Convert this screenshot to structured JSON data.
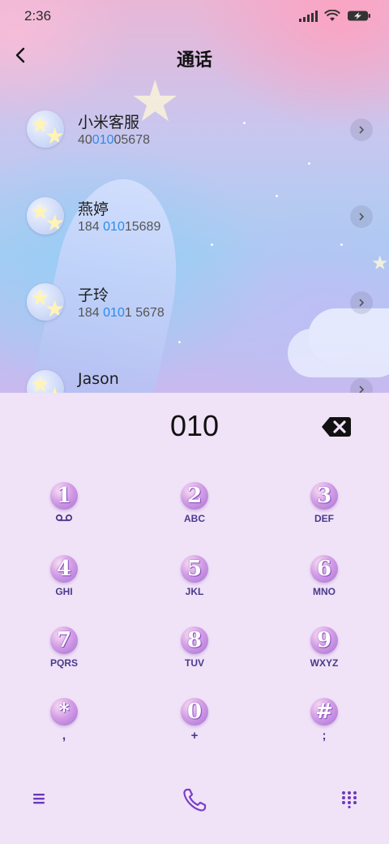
{
  "status_bar": {
    "time": "2:36",
    "icons": [
      "signal-icon",
      "wifi-icon",
      "battery-charging-icon"
    ]
  },
  "header": {
    "title": "通话",
    "back_icon": "chevron-left-icon"
  },
  "contacts": [
    {
      "name": "小米客服",
      "number_pre": "40",
      "number_match": "010",
      "number_post": "05678"
    },
    {
      "name": "燕婷",
      "number_pre": "184 ",
      "number_match": "010",
      "number_post": "15689"
    },
    {
      "name": "子玲",
      "number_pre": "184 ",
      "number_match": "010",
      "number_post": "1 5678"
    },
    {
      "name": "Jason",
      "number_pre": "",
      "number_match": "",
      "number_post": ""
    }
  ],
  "dialer": {
    "input_value": "010",
    "keys": [
      {
        "digit": "1",
        "sub": "ᴑᴑ"
      },
      {
        "digit": "2",
        "sub": "ABC"
      },
      {
        "digit": "3",
        "sub": "DEF"
      },
      {
        "digit": "4",
        "sub": "GHI"
      },
      {
        "digit": "5",
        "sub": "JKL"
      },
      {
        "digit": "6",
        "sub": "MNO"
      },
      {
        "digit": "7",
        "sub": "PQRS"
      },
      {
        "digit": "8",
        "sub": "TUV"
      },
      {
        "digit": "9",
        "sub": "WXYZ"
      },
      {
        "digit": "*",
        "sub": ","
      },
      {
        "digit": "0",
        "sub": "+"
      },
      {
        "digit": "#",
        "sub": ";"
      }
    ]
  },
  "colors": {
    "match_highlight": "#2d8be6",
    "dialer_background": "#f0e2f7",
    "accent_purple": "#7a3fc8"
  }
}
